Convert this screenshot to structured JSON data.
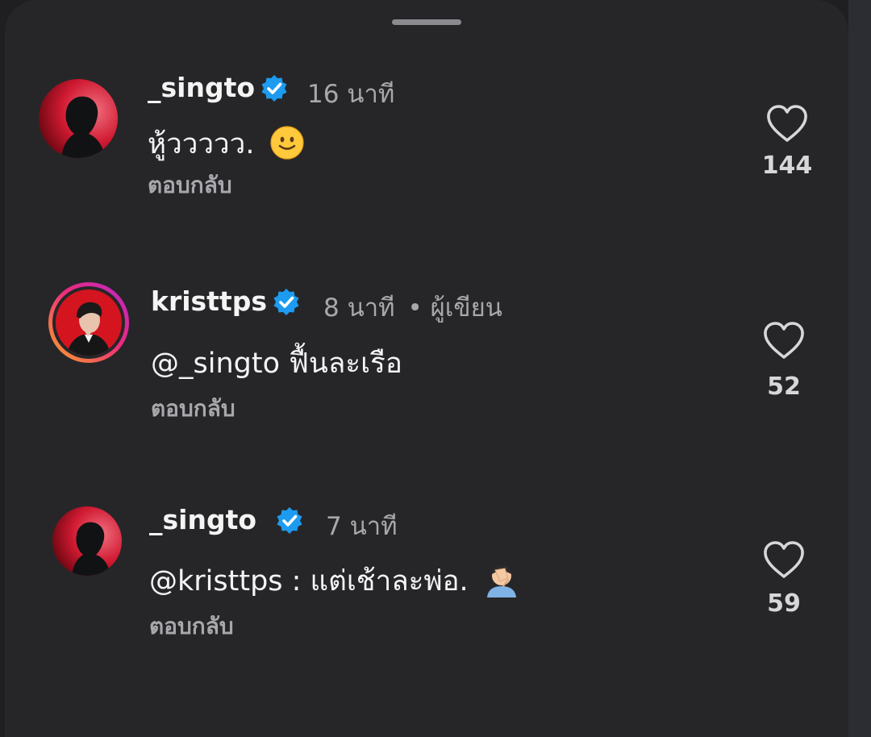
{
  "comments": [
    {
      "username": "_singto",
      "verified": true,
      "time": "16 นาที",
      "author_tag": "",
      "text": "หู้ววววว.",
      "emoji": "slightly-smiling-face",
      "reply_label": "ตอบกลับ",
      "likes": "144"
    },
    {
      "username": "kristtps",
      "verified": true,
      "time": "8 นาที",
      "author_tag": "• ผู้เขียน",
      "mention": "@",
      "text": "_singto ฟื้นละเรือ",
      "emoji": "",
      "reply_label": "ตอบกลับ",
      "likes": "52"
    },
    {
      "username": "_singto",
      "verified": true,
      "time": "7 นาที",
      "author_tag": "",
      "mention": "@",
      "text": "kristtps : แต่เช้าละพ่อ.",
      "emoji": "face-palm",
      "reply_label": "ตอบกลับ",
      "likes": "59"
    }
  ],
  "colors": {
    "background": "#262629",
    "verified": "#1d9bf0",
    "muted_text": "#a8a8ac",
    "primary_text": "#f4f4f4"
  },
  "icons": {
    "verified": "verified-badge-icon",
    "like": "heart-outline-icon",
    "handle": "drag-handle"
  }
}
